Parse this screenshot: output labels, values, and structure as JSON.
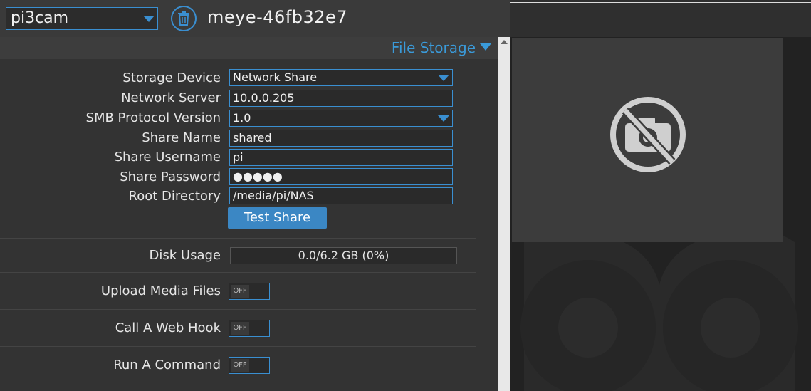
{
  "header": {
    "camera_select_value": "pi3cam",
    "camera_name": "meye-46fb32e7"
  },
  "section": {
    "title": "File Storage"
  },
  "form": {
    "storage_device": {
      "label": "Storage Device",
      "value": "Network Share"
    },
    "network_server": {
      "label": "Network Server",
      "value": "10.0.0.205"
    },
    "smb_version": {
      "label": "SMB Protocol Version",
      "value": "1.0"
    },
    "share_name": {
      "label": "Share Name",
      "value": "shared"
    },
    "share_username": {
      "label": "Share Username",
      "value": "pi"
    },
    "share_password": {
      "label": "Share Password",
      "value": "●●●●●"
    },
    "root_directory": {
      "label": "Root Directory",
      "value": "/media/pi/NAS"
    },
    "test_button": "Test Share"
  },
  "disk": {
    "label": "Disk Usage",
    "value": "0.0/6.2 GB (0%)"
  },
  "toggles": {
    "upload": {
      "label": "Upload Media Files",
      "state": "OFF"
    },
    "webhook": {
      "label": "Call A Web Hook",
      "state": "OFF"
    },
    "command": {
      "label": "Run A Command",
      "state": "OFF"
    }
  },
  "colors": {
    "accent": "#3a8fd1",
    "button": "#3b87c4"
  },
  "icons": {
    "delete": "trash-icon",
    "camera_preview": "no-camera-icon"
  }
}
